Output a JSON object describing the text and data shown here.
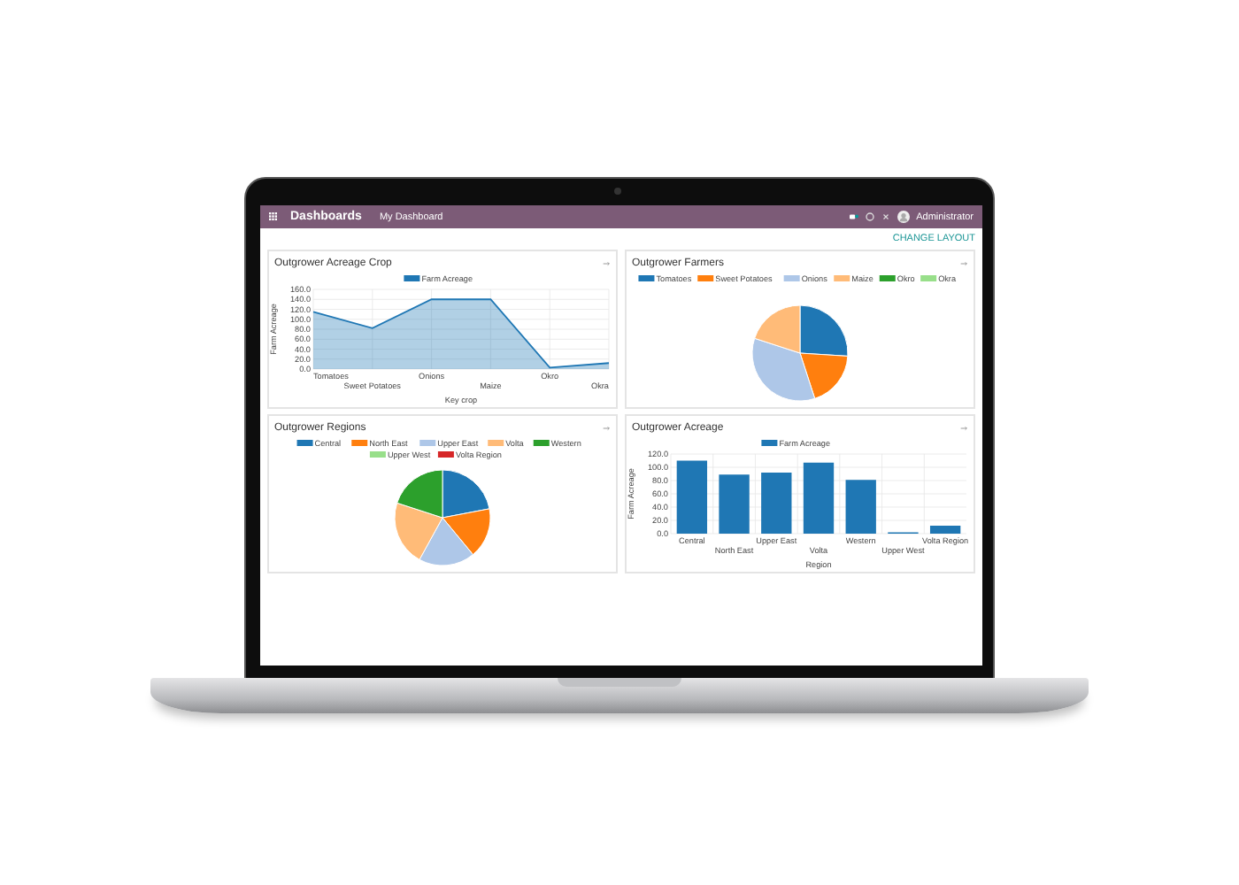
{
  "navbar": {
    "app_title": "Dashboards",
    "menu": "My Dashboard",
    "user": "Administrator"
  },
  "change_layout": "CHANGE LAYOUT",
  "cards": [
    {
      "title": "Outgrower Acreage Crop",
      "chart_data": {
        "type": "area",
        "grid": true,
        "legend": "top",
        "categories": [
          "Tomatoes",
          "Sweet Potatoes",
          "Onions",
          "Maize",
          "Okro",
          "Okra"
        ],
        "series": [
          {
            "name": "Farm Acreage",
            "color": "#1f77b4",
            "values": [
              115,
              82,
              140,
              140,
              3,
              12
            ]
          }
        ],
        "xlabel": "Key crop",
        "ylabel": "Farm Acreage",
        "ylim": [
          0,
          160
        ],
        "yticks": [
          {
            "value": 0,
            "label": "0.0"
          },
          {
            "value": 20,
            "label": "20.0"
          },
          {
            "value": 40,
            "label": "40.0"
          },
          {
            "value": 60,
            "label": "60.0"
          },
          {
            "value": 80,
            "label": "80.0"
          },
          {
            "value": 100,
            "label": "100.0"
          },
          {
            "value": 120,
            "label": "120.0"
          },
          {
            "value": 140,
            "label": "140.0"
          },
          {
            "value": 160,
            "label": "160.0"
          }
        ]
      }
    },
    {
      "title": "Outgrower Farmers",
      "chart_data": {
        "type": "pie",
        "legend": "top",
        "categories": [
          "Tomatoes",
          "Sweet Potatoes",
          "Onions",
          "Maize",
          "Okro",
          "Okra"
        ],
        "colors": [
          "#1f77b4",
          "#ff7f0e",
          "#aec7e8",
          "#ffbb78",
          "#2ca02c",
          "#98df8a"
        ],
        "values": [
          26,
          19,
          35,
          20,
          0,
          0
        ]
      }
    },
    {
      "title": "Outgrower Regions",
      "chart_data": {
        "type": "pie",
        "legend": "top",
        "categories": [
          "Central",
          "North East",
          "Upper East",
          "Volta",
          "Western",
          "Upper West",
          "Volta Region"
        ],
        "colors": [
          "#1f77b4",
          "#ff7f0e",
          "#aec7e8",
          "#ffbb78",
          "#2ca02c",
          "#98df8a",
          "#d62728"
        ],
        "values": [
          22,
          17,
          19,
          22,
          20,
          0,
          0
        ]
      }
    },
    {
      "title": "Outgrower Acreage",
      "chart_data": {
        "type": "bar",
        "grid": true,
        "legend": "top",
        "categories": [
          "Central",
          "North East",
          "Upper East",
          "Volta",
          "Western",
          "Upper West",
          "Volta Region"
        ],
        "series": [
          {
            "name": "Farm Acreage",
            "color": "#1f77b4",
            "values": [
              110,
              89,
              92,
              107,
              81,
              2,
              12
            ]
          }
        ],
        "xlabel": "Region",
        "ylabel": "Farm Acreage",
        "ylim": [
          0,
          120
        ],
        "yticks": [
          {
            "value": 0,
            "label": "0.0"
          },
          {
            "value": 20,
            "label": "20.0"
          },
          {
            "value": 40,
            "label": "40.0"
          },
          {
            "value": 60,
            "label": "60.0"
          },
          {
            "value": 80,
            "label": "80.0"
          },
          {
            "value": 100,
            "label": "100.0"
          },
          {
            "value": 120,
            "label": "120.0"
          }
        ]
      }
    }
  ]
}
